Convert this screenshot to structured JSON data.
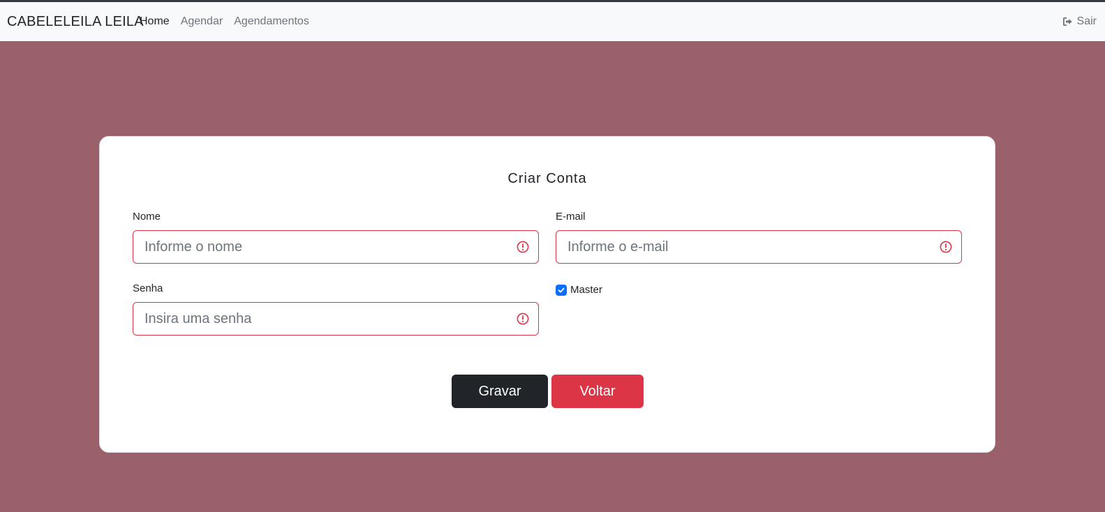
{
  "navbar": {
    "brand": "CABELELEILA LEILA",
    "links": [
      {
        "label": "Home",
        "active": true
      },
      {
        "label": "Agendar",
        "active": false
      },
      {
        "label": "Agendamentos",
        "active": false
      }
    ],
    "logout_label": "Sair",
    "logout_icon": "sign-out-icon"
  },
  "form": {
    "title": "Criar Conta",
    "name_label": "Nome",
    "name_placeholder": "Informe o nome",
    "name_value": "",
    "email_label": "E-mail",
    "email_placeholder": "Informe o e-mail",
    "email_value": "",
    "password_label": "Senha",
    "password_placeholder": "Insira uma senha",
    "password_value": "",
    "master_label": "Master",
    "master_checked": true,
    "save_label": "Gravar",
    "back_label": "Voltar"
  },
  "colors": {
    "background": "#9a616b",
    "danger": "#dc3545",
    "dark": "#212529",
    "checkbox": "#0d6efd"
  }
}
